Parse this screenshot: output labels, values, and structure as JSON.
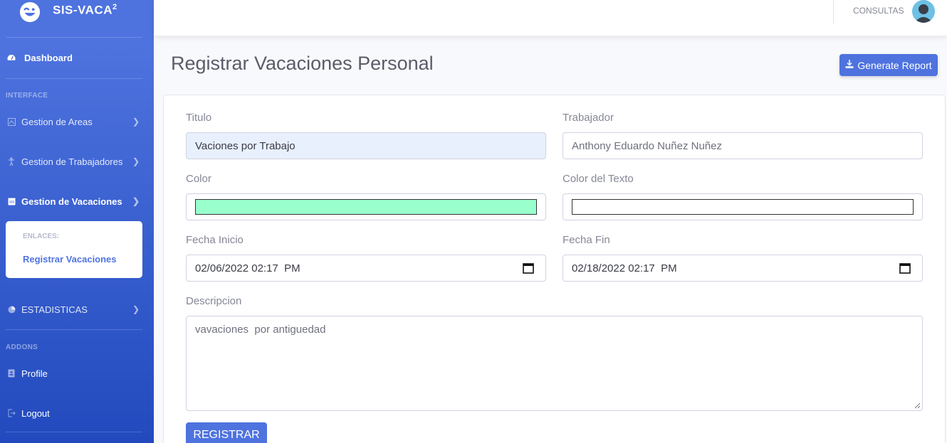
{
  "brand": {
    "name": "SIS-VACA",
    "sup": "2"
  },
  "sidebar": {
    "dashboard": "Dashboard",
    "heading_interface": "INTERFACE",
    "items": [
      {
        "label": "Gestion de Areas",
        "icon": "map-icon"
      },
      {
        "label": "Gestion de Trabajadores",
        "icon": "person-icon"
      },
      {
        "label": "Gestion de Vacaciones",
        "icon": "calendar-icon"
      }
    ],
    "submenu": {
      "header": "ENLACES:",
      "item": "Registrar Vacaciones"
    },
    "estadisticas": "ESTADISTICAS",
    "heading_addons": "ADDONS",
    "profile": "Profile",
    "logout": "Logout"
  },
  "topbar": {
    "user": "CONSULTAS"
  },
  "page": {
    "title": "Registrar Vacaciones Personal",
    "report_button": "Generate Report"
  },
  "form": {
    "titulo_label": "Titulo",
    "titulo_value": "Vaciones por Trabajo",
    "trabajador_label": "Trabajador",
    "trabajador_value": "Anthony Eduardo Nuñez Nuñez",
    "color_label": "Color",
    "color_value": "#99ffcc",
    "color_texto_label": "Color del Texto",
    "color_texto_value": "#ffffff",
    "fecha_inicio_label": "Fecha Inicio",
    "fecha_inicio_value": "02/06/2022 02:17  PM",
    "fecha_fin_label": "Fecha Fin",
    "fecha_fin_value": "02/18/2022 02:17  PM",
    "descripcion_label": "Descripcion",
    "descripcion_value": "vavaciones  por antiguedad",
    "submit": "REGISTRAR"
  }
}
